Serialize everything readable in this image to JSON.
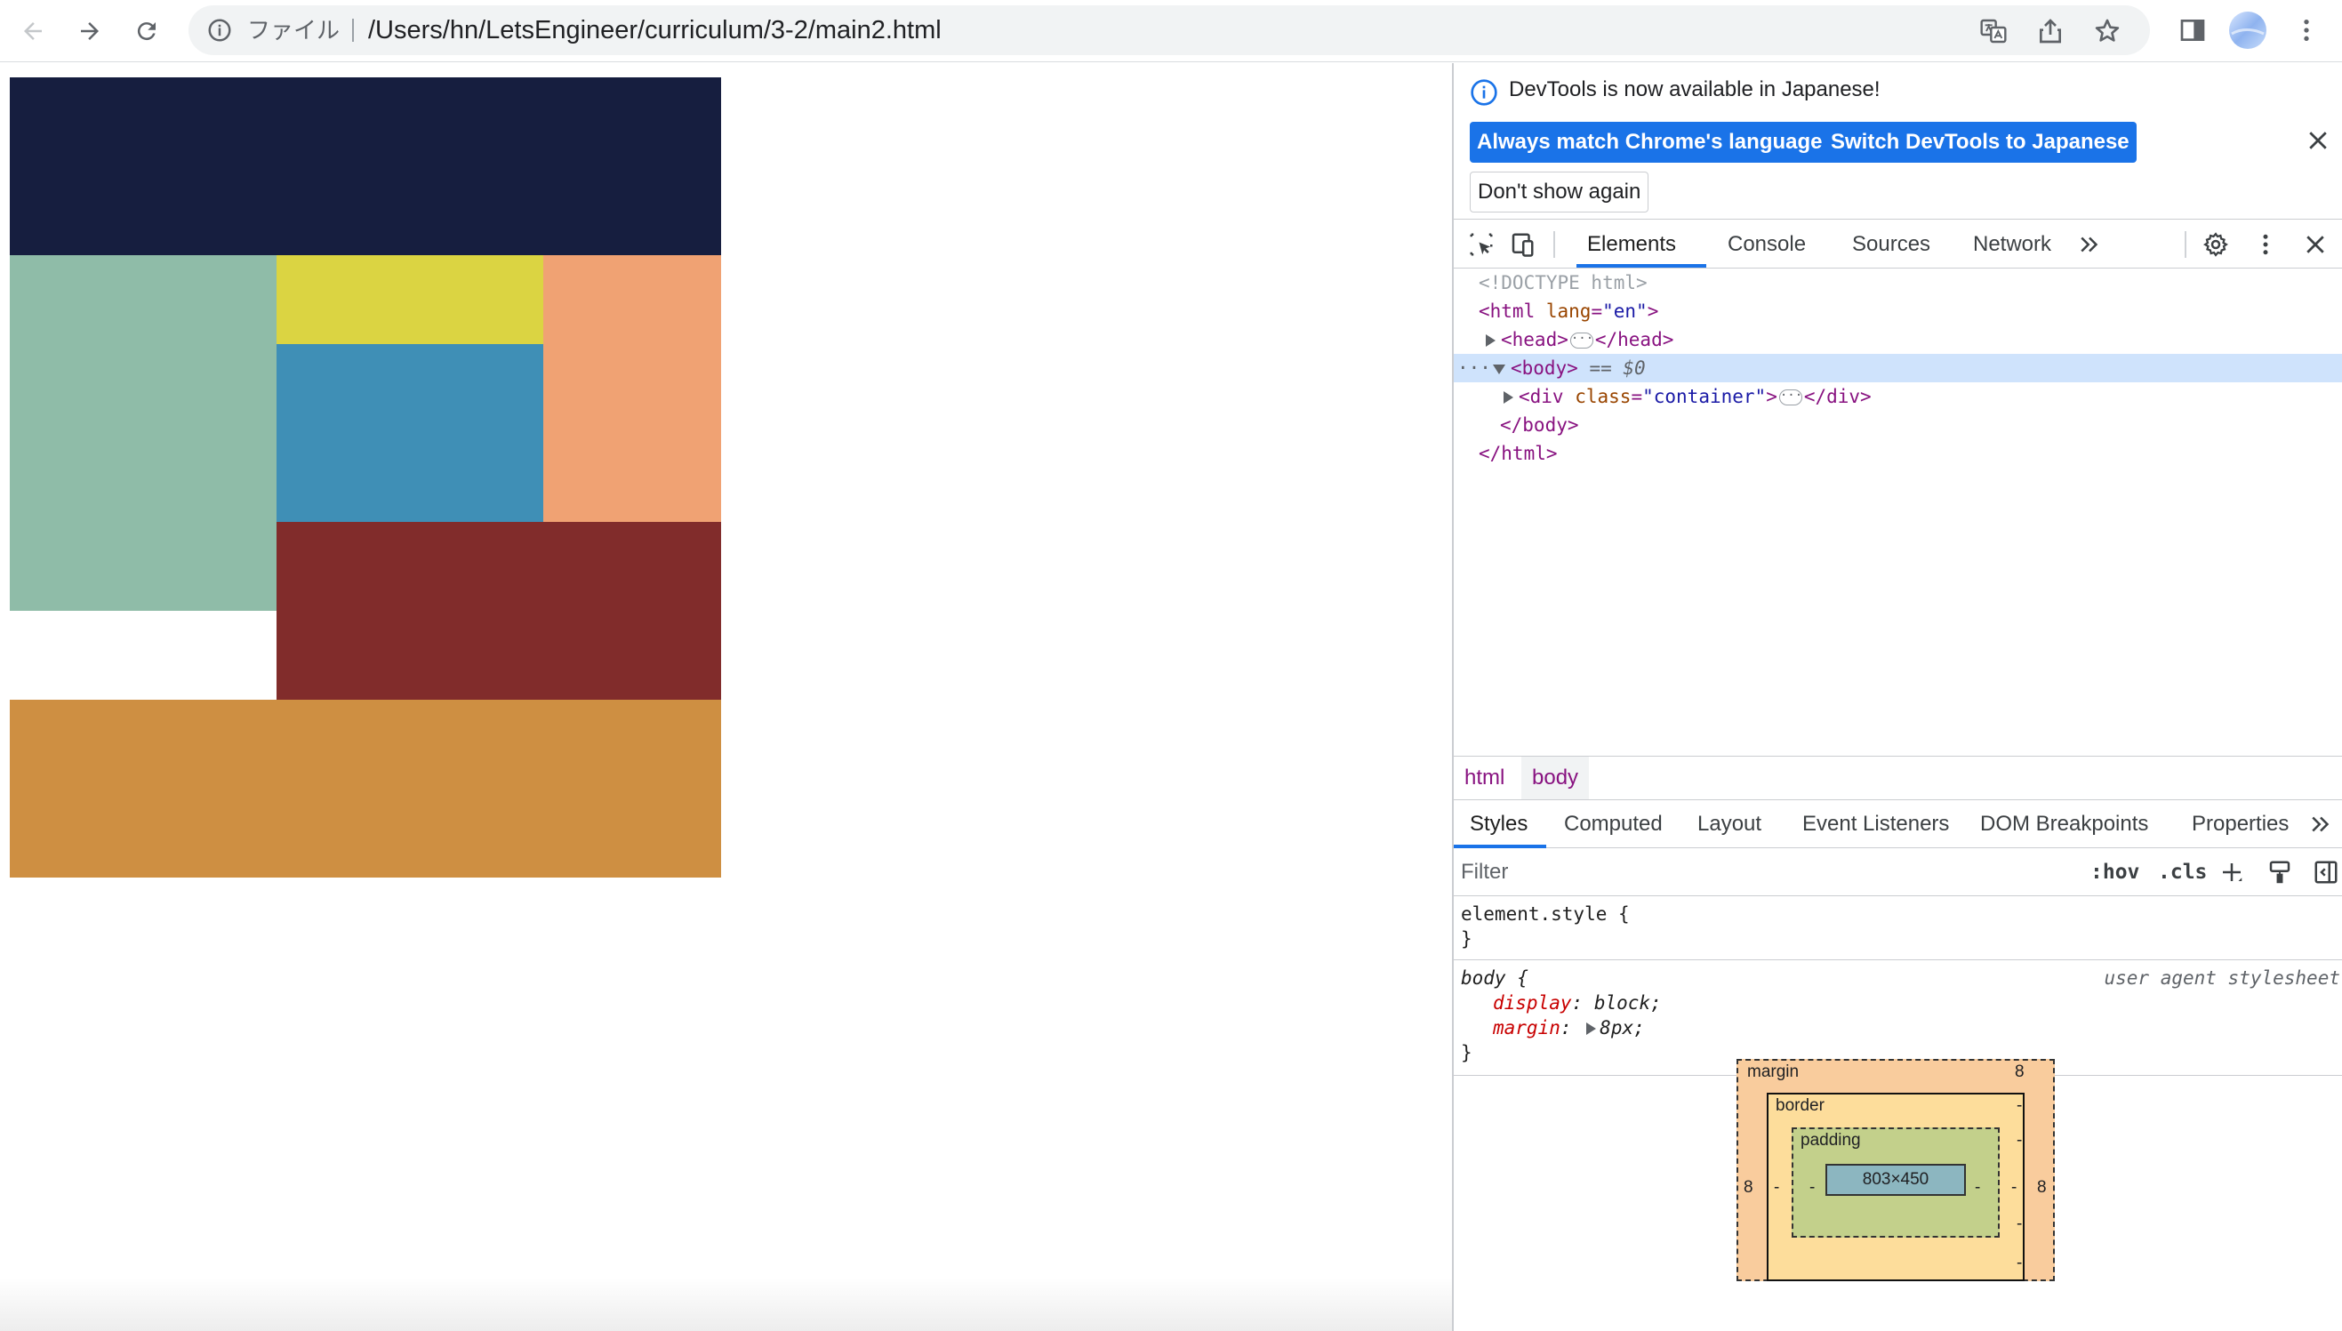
{
  "browser": {
    "url_scheme_label": "ファイル",
    "url": "/Users/hn/LetsEngineer/curriculum/3-2/main2.html"
  },
  "page": {
    "blocks": [
      {
        "name": "header-block",
        "color": "#161e3f"
      },
      {
        "name": "left-sidebar-block",
        "color": "#8fbca8"
      },
      {
        "name": "yellow-block",
        "color": "#dbd442"
      },
      {
        "name": "blue-block",
        "color": "#3f8fb6"
      },
      {
        "name": "orange-block",
        "color": "#f0a273"
      },
      {
        "name": "red-block",
        "color": "#812c2b"
      },
      {
        "name": "footer-block",
        "color": "#ce8f42"
      }
    ]
  },
  "devtools": {
    "infobar": {
      "message": "DevTools is now available in Japanese!",
      "match_language_label": "Always match Chrome's language",
      "switch_language_label": "Switch DevTools to Japanese",
      "dont_show_label": "Don't show again"
    },
    "tabs": [
      "Elements",
      "Console",
      "Sources",
      "Network"
    ],
    "dom": {
      "doctype": "<!DOCTYPE html>",
      "html_open": "<html",
      "lang_attr": "lang",
      "lang_val": "\"en\"",
      "gt": ">",
      "head_open": "<head>",
      "head_close": "</head>",
      "body_open": "<body>",
      "selected_marker": "== $0",
      "div_open": "<div",
      "class_attr": "class",
      "class_val": "\"container\"",
      "div_close": "</div>",
      "body_close": "</body>",
      "html_close": "</html>",
      "row_dots": "···"
    },
    "breadcrumbs": [
      "html",
      "body"
    ],
    "subtabs": [
      "Styles",
      "Computed",
      "Layout",
      "Event Listeners",
      "DOM Breakpoints",
      "Properties"
    ],
    "filter": {
      "placeholder": "Filter",
      "hov": ":hov",
      "cls": ".cls"
    },
    "styles": {
      "element_style_selector": "element.style {",
      "close_brace": "}",
      "body_selector": "body {",
      "user_agent_label": "user agent stylesheet",
      "prop1_name": "display",
      "prop1_value": "block;",
      "prop2_name": "margin",
      "prop2_value": "8px;",
      "colon": ":"
    },
    "box_model": {
      "margin_label": "margin",
      "margin_top": "8",
      "margin_left": "8",
      "margin_right": "8",
      "border_label": "border",
      "border_top": "-",
      "border_left": "-",
      "border_right": "-",
      "border_bottom": "-",
      "padding_label": "padding",
      "padding_top": "-",
      "padding_left": "-",
      "padding_right": "-",
      "padding_bottom": "-",
      "content_size": "803×450"
    },
    "colors": {
      "accent": "#1a73e8",
      "tag": "#881280",
      "attribute": "#994500",
      "attribute_value": "#1a1aa6",
      "property": "#c80000"
    }
  }
}
